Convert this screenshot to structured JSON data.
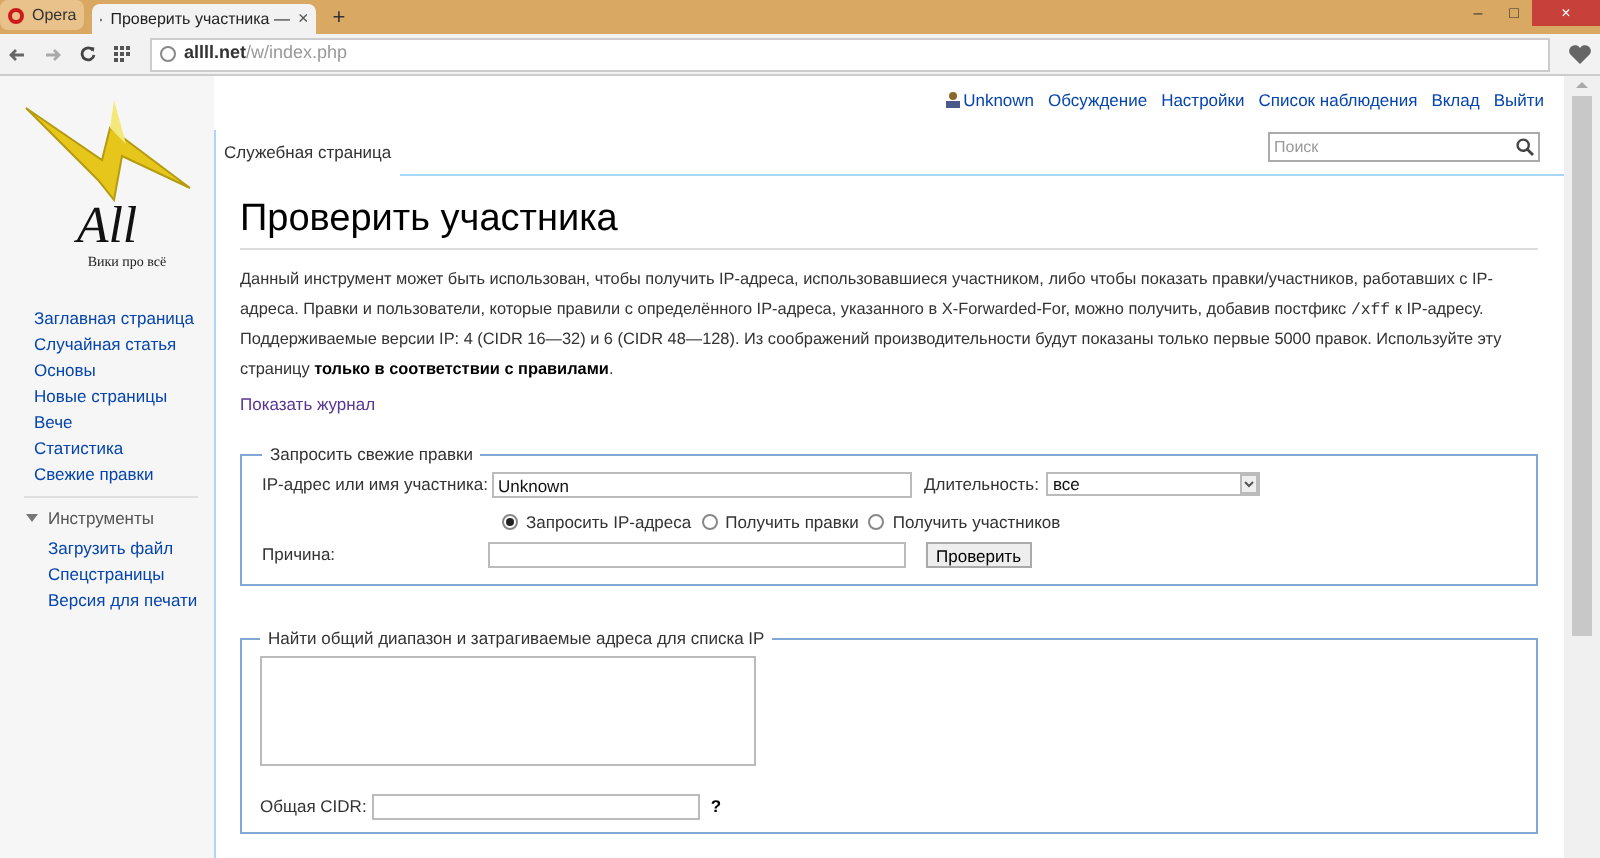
{
  "browser": {
    "menu_label": "Opera",
    "tabs": [
      {
        "title": "Проверить участника — ",
        "selected": true,
        "close": "×"
      }
    ],
    "new_tab": "+",
    "url": {
      "host": "allll.net",
      "path": "/w/index.php"
    },
    "window_controls": [
      "–",
      "□",
      "×"
    ]
  },
  "logo": {
    "wordmark": "All",
    "tagline": "Вики про всё"
  },
  "personal_links": [
    {
      "label": "Unknown",
      "kind": "user"
    },
    {
      "label": "Обсуждение",
      "kind": "link"
    },
    {
      "label": "Настройки",
      "kind": "link"
    },
    {
      "label": "Список наблюдения",
      "kind": "link"
    },
    {
      "label": "Вклад",
      "kind": "link"
    },
    {
      "label": "Выйти",
      "kind": "link"
    }
  ],
  "page_tabs": [
    {
      "label": "Служебная страница",
      "selected": true
    }
  ],
  "search": {
    "placeholder": "Поиск"
  },
  "sidebar": {
    "items": [
      {
        "label": "Заглавная страница"
      },
      {
        "label": "Случайная статья"
      },
      {
        "label": "Основы"
      },
      {
        "label": "Новые страницы"
      },
      {
        "label": "Вече"
      },
      {
        "label": "Статистика"
      },
      {
        "label": "Свежие правки"
      }
    ],
    "sections": [
      {
        "title": "Инструменты",
        "expanded": true,
        "items": [
          {
            "label": "Загрузить файл"
          },
          {
            "label": "Спецстраницы"
          },
          {
            "label": "Версия для печати"
          }
        ]
      }
    ]
  },
  "heading": "Проверить участника",
  "intro": [
    {
      "kind": "plain",
      "text": "Данный инструмент может быть использован, чтобы получить IP-адреса, использовавшиеся участником, либо чтобы показать правки/участников, работавших с IP-адреса. Правки и пользователи, которые правили с определённого IP-адреса, указанного в X-Forwarded-For, можно получить, добавив постфикс "
    },
    {
      "kind": "code",
      "text": "/xff"
    },
    {
      "kind": "plain",
      "text": " к IP-адресу. Поддерживаемые версии IP: 4 (CIDR 16—32) и 6 (CIDR 48—128). Из соображений производительности будут показаны только первые 5000 правок. Используйте эту страницу "
    },
    {
      "kind": "bold",
      "text": "только в соответствии с правилами"
    },
    {
      "kind": "plain",
      "text": "."
    }
  ],
  "log_link": "Показать журнал",
  "check_form": {
    "legend": "Запросить свежие правки",
    "target_label": "IP-адрес или имя участника:",
    "target_value": "Unknown",
    "duration_label": "Длительность:",
    "duration_value": "все",
    "modes": [
      {
        "label": "Запросить IP-адреса",
        "selected": true
      },
      {
        "label": "Получить правки",
        "selected": false
      },
      {
        "label": "Получить участников",
        "selected": false
      }
    ],
    "reason_label": "Причина:",
    "submit": "Проверить"
  },
  "range_form": {
    "legend": "Найти общий диапазон и затрагиваемые адреса для списка IP",
    "cidr_label": "Общая CIDR:",
    "help": "?"
  }
}
